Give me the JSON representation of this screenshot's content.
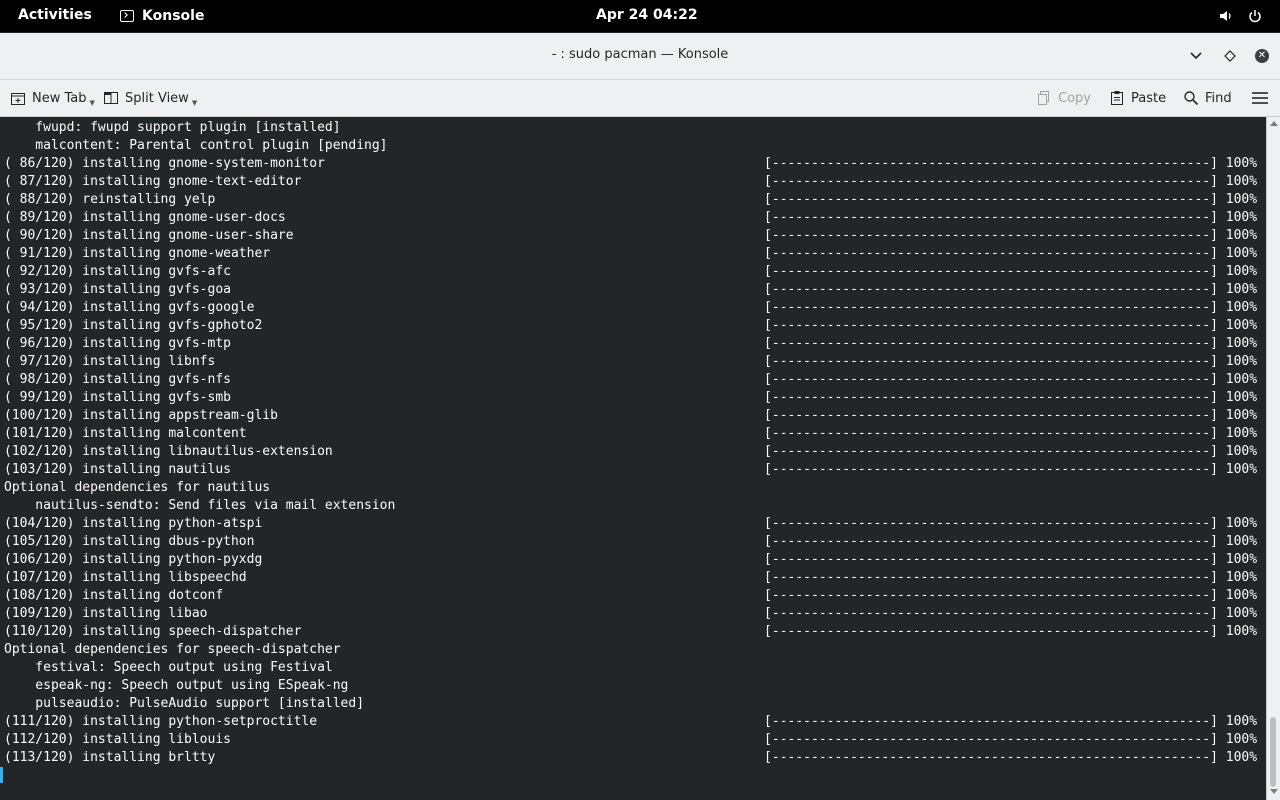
{
  "topbar": {
    "activities": "Activities",
    "app_name": "Konsole",
    "clock": "Apr 24  04:22"
  },
  "window": {
    "title": "- : sudo pacman — Konsole"
  },
  "toolbar": {
    "new_tab": "New Tab",
    "split_view": "Split View",
    "copy": "Copy",
    "paste": "Paste",
    "find": "Find"
  },
  "terminal": {
    "lines": [
      {
        "text": "    fwupd: fwupd support plugin [installed]",
        "bar": ""
      },
      {
        "text": "    malcontent: Parental control plugin [pending]",
        "bar": ""
      },
      {
        "text": "( 86/120) installing gnome-system-monitor",
        "bar": "[--------------------------------------------------------] 100%"
      },
      {
        "text": "( 87/120) installing gnome-text-editor",
        "bar": "[--------------------------------------------------------] 100%"
      },
      {
        "text": "( 88/120) reinstalling yelp",
        "bar": "[--------------------------------------------------------] 100%"
      },
      {
        "text": "( 89/120) installing gnome-user-docs",
        "bar": "[--------------------------------------------------------] 100%"
      },
      {
        "text": "( 90/120) installing gnome-user-share",
        "bar": "[--------------------------------------------------------] 100%"
      },
      {
        "text": "( 91/120) installing gnome-weather",
        "bar": "[--------------------------------------------------------] 100%"
      },
      {
        "text": "( 92/120) installing gvfs-afc",
        "bar": "[--------------------------------------------------------] 100%"
      },
      {
        "text": "( 93/120) installing gvfs-goa",
        "bar": "[--------------------------------------------------------] 100%"
      },
      {
        "text": "( 94/120) installing gvfs-google",
        "bar": "[--------------------------------------------------------] 100%"
      },
      {
        "text": "( 95/120) installing gvfs-gphoto2",
        "bar": "[--------------------------------------------------------] 100%"
      },
      {
        "text": "( 96/120) installing gvfs-mtp",
        "bar": "[--------------------------------------------------------] 100%"
      },
      {
        "text": "( 97/120) installing libnfs",
        "bar": "[--------------------------------------------------------] 100%"
      },
      {
        "text": "( 98/120) installing gvfs-nfs",
        "bar": "[--------------------------------------------------------] 100%"
      },
      {
        "text": "( 99/120) installing gvfs-smb",
        "bar": "[--------------------------------------------------------] 100%"
      },
      {
        "text": "(100/120) installing appstream-glib",
        "bar": "[--------------------------------------------------------] 100%"
      },
      {
        "text": "(101/120) installing malcontent",
        "bar": "[--------------------------------------------------------] 100%"
      },
      {
        "text": "(102/120) installing libnautilus-extension",
        "bar": "[--------------------------------------------------------] 100%"
      },
      {
        "text": "(103/120) installing nautilus",
        "bar": "[--------------------------------------------------------] 100%"
      },
      {
        "text": "Optional dependencies for nautilus",
        "bar": ""
      },
      {
        "text": "    nautilus-sendto: Send files via mail extension",
        "bar": ""
      },
      {
        "text": "(104/120) installing python-atspi",
        "bar": "[--------------------------------------------------------] 100%"
      },
      {
        "text": "(105/120) installing dbus-python",
        "bar": "[--------------------------------------------------------] 100%"
      },
      {
        "text": "(106/120) installing python-pyxdg",
        "bar": "[--------------------------------------------------------] 100%"
      },
      {
        "text": "(107/120) installing libspeechd",
        "bar": "[--------------------------------------------------------] 100%"
      },
      {
        "text": "(108/120) installing dotconf",
        "bar": "[--------------------------------------------------------] 100%"
      },
      {
        "text": "(109/120) installing libao",
        "bar": "[--------------------------------------------------------] 100%"
      },
      {
        "text": "(110/120) installing speech-dispatcher",
        "bar": "[--------------------------------------------------------] 100%"
      },
      {
        "text": "Optional dependencies for speech-dispatcher",
        "bar": ""
      },
      {
        "text": "    festival: Speech output using Festival",
        "bar": ""
      },
      {
        "text": "    espeak-ng: Speech output using ESpeak-ng",
        "bar": ""
      },
      {
        "text": "    pulseaudio: PulseAudio support [installed]",
        "bar": ""
      },
      {
        "text": "(111/120) installing python-setproctitle",
        "bar": "[--------------------------------------------------------] 100%"
      },
      {
        "text": "(112/120) installing liblouis",
        "bar": "[--------------------------------------------------------] 100%"
      },
      {
        "text": "(113/120) installing brltty",
        "bar": "[--------------------------------------------------------] 100%"
      }
    ]
  }
}
